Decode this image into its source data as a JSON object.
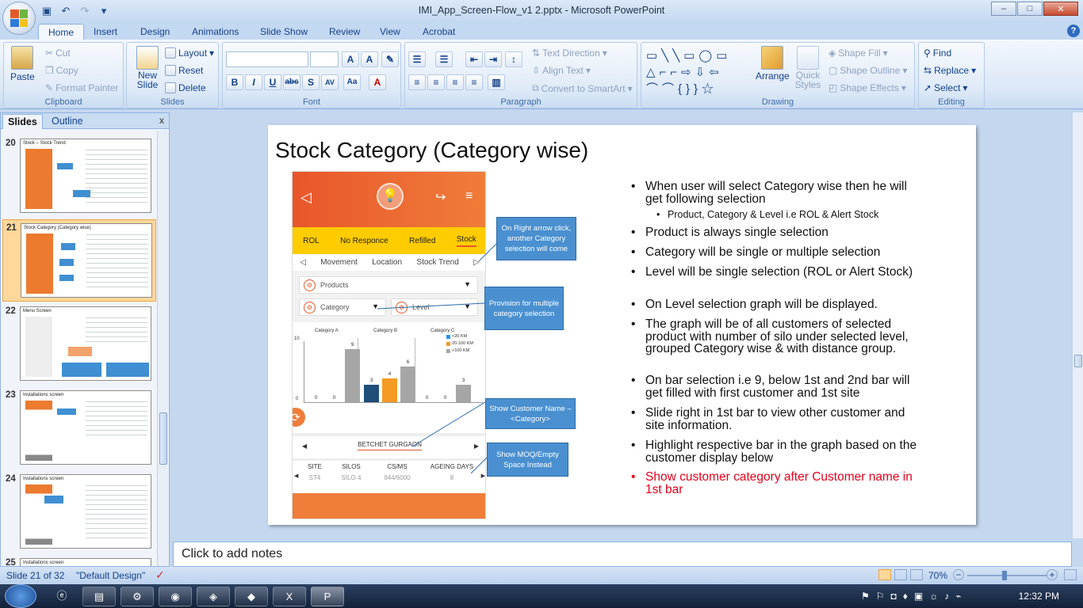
{
  "window": {
    "title": "IMI_App_Screen-Flow_v1 2.pptx - Microsoft PowerPoint",
    "controls": {
      "minimize": "–",
      "maximize": "□",
      "close": "✕"
    }
  },
  "ribbon_tabs": [
    "Home",
    "Insert",
    "Design",
    "Animations",
    "Slide Show",
    "Review",
    "View",
    "Acrobat"
  ],
  "ribbon": {
    "clipboard": {
      "label": "Clipboard",
      "paste": "Paste",
      "cut": "Cut",
      "copy": "Copy",
      "format_painter": "Format Painter"
    },
    "slides": {
      "label": "Slides",
      "new_slide": "New Slide",
      "layout": "Layout",
      "reset": "Reset",
      "delete": "Delete"
    },
    "font": {
      "label": "Font",
      "bold": "B",
      "italic": "I",
      "underline": "U",
      "strike": "abc",
      "shadow": "S",
      "spacing": "AV",
      "case": "Aa",
      "color": "A"
    },
    "paragraph": {
      "label": "Paragraph",
      "text_direction": "Text Direction",
      "align_text": "Align Text",
      "convert": "Convert to SmartArt"
    },
    "drawing": {
      "label": "Drawing",
      "arrange": "Arrange",
      "quick_styles": "Quick Styles",
      "shape_fill": "Shape Fill",
      "shape_outline": "Shape Outline",
      "shape_effects": "Shape Effects"
    },
    "editing": {
      "label": "Editing",
      "find": "Find",
      "replace": "Replace",
      "select": "Select"
    }
  },
  "pane": {
    "tab_slides": "Slides",
    "tab_outline": "Outline",
    "close": "x",
    "thumbnails": [
      {
        "num": "20",
        "title": "Stock – Stock Trend"
      },
      {
        "num": "21",
        "title": "Stock Category (Category wise)"
      },
      {
        "num": "22",
        "title": "Menu Screen"
      },
      {
        "num": "23",
        "title": "Installations screen"
      },
      {
        "num": "24",
        "title": "Installations screen"
      }
    ],
    "partial_num": "25",
    "partial_title": "Installations screen"
  },
  "slide": {
    "title": "Stock Category (Category wise)",
    "phone": {
      "status_tabs": [
        "ROL",
        "No Responce",
        "Refilled",
        "Stock"
      ],
      "nav_tabs": [
        "Movement",
        "Location",
        "Stock Trend"
      ],
      "select_products": "Products",
      "select_category": "Category",
      "select_level": "Level",
      "chart": {
        "ymax": "10",
        "ymin": "0",
        "groups": [
          "Category A",
          "Category B",
          "Category C"
        ],
        "legend": [
          "<20 KM",
          "20-100 KM",
          ">100 KM"
        ]
      },
      "customer": "BETCHET GURGAON",
      "grid_headers": [
        "SITE",
        "SILOS",
        "CS/MS",
        "AGEING DAYS"
      ],
      "grid_values": [
        "ST4",
        "SILO 4",
        "944/6000",
        "8"
      ]
    },
    "callouts": {
      "right_arrow": "On Right arrow click, another Category selection will come",
      "multiple": "Provision for multiple  category selection",
      "customer_name": "Show Customer Name –<Category>",
      "moq": "Show MOQ/Empty Space Instead"
    },
    "bullets": [
      "When user will select  Category wise then he will get following selection",
      "Product, Category & Level i.e ROL & Alert Stock",
      "Product is always single selection",
      "Category will be single or multiple selection",
      "Level will be single selection (ROL or Alert Stock)",
      "On Level selection  graph will be displayed.",
      "The graph will be of all customers of selected product with number of silo under selected level, grouped Category wise & with distance group.",
      "On bar selection i.e 9, below 1st and 2nd bar will get filled with first customer and 1st site",
      "Slide right in 1st bar to view other customer and site information.",
      "Highlight respective bar in the graph based on the customer display below",
      "Show customer category after Customer name in 1st bar"
    ]
  },
  "chart_data": {
    "type": "bar",
    "categories": [
      "Category A",
      "Category B",
      "Category C"
    ],
    "series": [
      {
        "name": "<20 KM",
        "values": [
          0,
          3,
          0
        ]
      },
      {
        "name": "20-100 KM",
        "values": [
          0,
          4,
          0
        ]
      },
      {
        "name": ">100 KM",
        "values": [
          9,
          6,
          3
        ]
      }
    ],
    "ylim": [
      0,
      10
    ],
    "colors": {
      "<20 KM": "#1f4e79",
      "20-100 KM": "#f59a23",
      ">100 KM": "#a6a6a6"
    }
  },
  "notes_placeholder": "Click to add notes",
  "status": {
    "slide": "Slide 21 of 32",
    "theme": "\"Default Design\"",
    "zoom": "70%"
  },
  "taskbar": {
    "time": "12:32 PM"
  }
}
